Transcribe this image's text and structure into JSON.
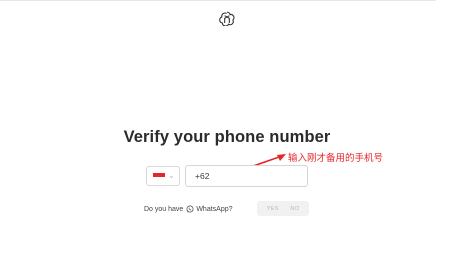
{
  "logo": {
    "icon": "openai-logo-icon"
  },
  "heading": {
    "title": "Verify your phone number"
  },
  "annotation": {
    "text": "输入刚才备用的手机号",
    "color": "#e8262a"
  },
  "phone": {
    "country_flag": "indonesia-flag-icon",
    "country_code_value": "+62"
  },
  "whatsapp": {
    "question_prefix": "Do you have",
    "app_name": "WhatsApp?",
    "yes_label": "YES",
    "no_label": "NO"
  }
}
